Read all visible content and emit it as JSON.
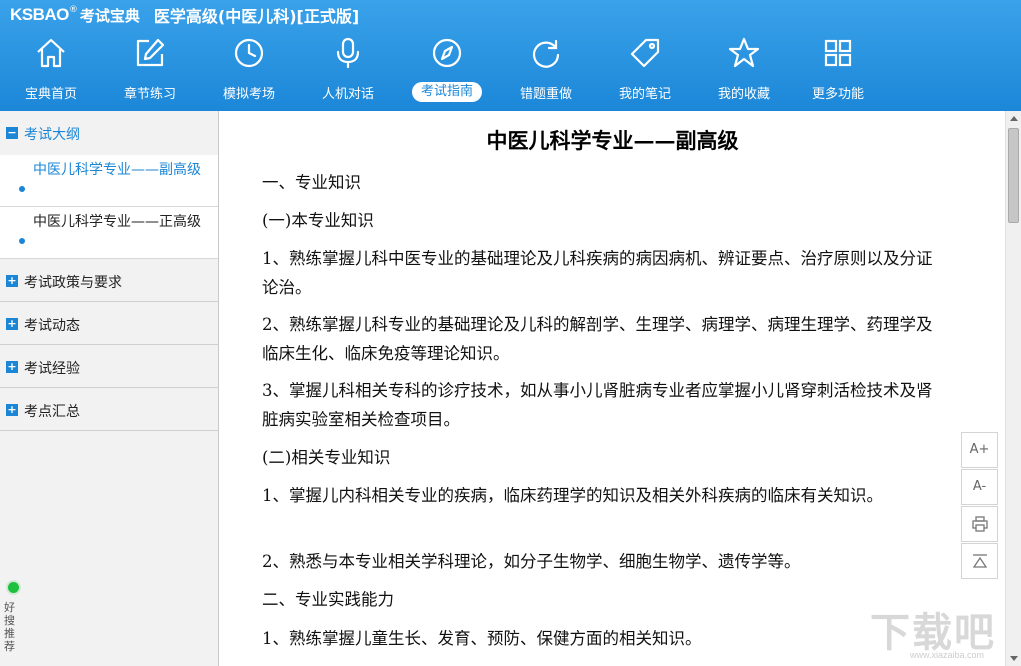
{
  "header": {
    "logo_en": "KSBAO",
    "logo_reg": "®",
    "logo_cn": "考试宝典",
    "app_title": "医学高级(中医儿科)[正式版]"
  },
  "toolbar": {
    "items": [
      {
        "label": "宝典首页",
        "icon": "home-icon"
      },
      {
        "label": "章节练习",
        "icon": "edit-icon"
      },
      {
        "label": "模拟考场",
        "icon": "clock-icon"
      },
      {
        "label": "人机对话",
        "icon": "microphone-icon"
      },
      {
        "label": "考试指南",
        "icon": "compass-icon",
        "active": true
      },
      {
        "label": "错题重做",
        "icon": "refresh-icon"
      },
      {
        "label": "我的笔记",
        "icon": "tag-icon"
      },
      {
        "label": "我的收藏",
        "icon": "star-icon"
      },
      {
        "label": "更多功能",
        "icon": "grid-icon"
      }
    ]
  },
  "sidebar": {
    "open_section": {
      "label": "考试大纲",
      "toggle": "−"
    },
    "subitems": [
      {
        "label": "中医儿科学专业——副高级",
        "active": true
      },
      {
        "label": "中医儿科学专业——正高级",
        "active": false
      }
    ],
    "sections": [
      {
        "label": "考试政策与要求",
        "toggle": "+"
      },
      {
        "label": "考试动态",
        "toggle": "+"
      },
      {
        "label": "考试经验",
        "toggle": "+"
      },
      {
        "label": "考点汇总",
        "toggle": "+"
      }
    ],
    "bottom_text": "好搜推荐"
  },
  "content": {
    "title": "中医儿科学专业——副高级",
    "paragraphs": [
      "一、专业知识",
      "(一)本专业知识",
      "1、熟练掌握儿科中医专业的基础理论及儿科疾病的病因病机、辨证要点、治疗原则以及分证论治。",
      "2、熟练掌握儿科专业的基础理论及儿科的解剖学、生理学、病理学、病理生理学、药理学及临床生化、临床免疫等理论知识。",
      "3、掌握儿科相关专科的诊疗技术，如从事小儿肾脏病专业者应掌握小儿肾穿刺活检技术及肾脏病实验室相关检查项目。",
      "(二)相关专业知识",
      "1、掌握儿内科相关专业的疾病，临床药理学的知识及相关外科疾病的临床有关知识。",
      "2、熟悉与本专业相关学科理论，如分子生物学、细胞生物学、遗传学等。",
      "二、专业实践能力",
      "1、熟练掌握儿童生长、发育、预防、保健方面的相关知识。"
    ]
  },
  "float_panel": {
    "font_increase": "A+",
    "font_decrease": "A-",
    "print_icon": "printer-icon",
    "top_icon": "back-to-top-icon"
  },
  "watermark": {
    "text": "下载吧",
    "url": "www.xiazaiba.com"
  },
  "colors": {
    "header_blue": "#1c87d8",
    "accent_blue": "#1b86d6"
  }
}
